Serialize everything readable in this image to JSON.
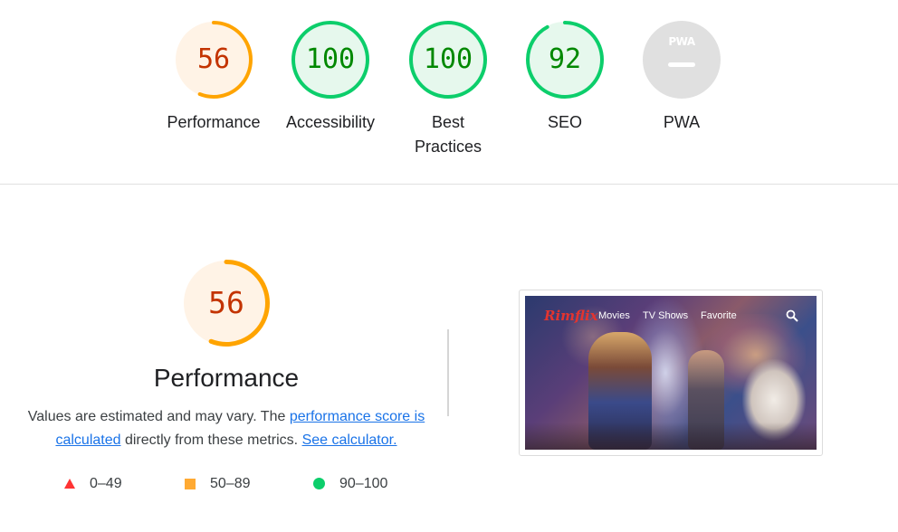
{
  "categories": [
    {
      "id": "performance",
      "score": 56,
      "score_text": "56",
      "label": "Performance",
      "status": "average"
    },
    {
      "id": "accessibility",
      "score": 100,
      "score_text": "100",
      "label": "Accessibility",
      "status": "pass"
    },
    {
      "id": "best-practices",
      "score": 100,
      "score_text": "100",
      "label_line1": "Best",
      "label_line2": "Practices",
      "status": "pass"
    },
    {
      "id": "seo",
      "score": 92,
      "score_text": "92",
      "label": "SEO",
      "status": "pass"
    },
    {
      "id": "pwa",
      "score_text": "PWA",
      "label": "PWA",
      "status": "na"
    }
  ],
  "colors": {
    "fail": "#ff3333",
    "average": "#ffa400",
    "average_text": "#c33300",
    "average_bg": "#fff3e6",
    "pass": "#0cce6b",
    "pass_text": "#008800",
    "pass_bg": "#e6f8ed",
    "na": "#e0e0e0",
    "link": "#1a73e8"
  },
  "performance_section": {
    "score": 56,
    "score_text": "56",
    "title": "Performance",
    "desc_prefix": "Values are estimated and may vary. The ",
    "link1": "performance score is calculated",
    "desc_middle": " directly from these metrics. ",
    "link2": "See calculator."
  },
  "legend": [
    {
      "icon": "red-triangle-icon",
      "range": "0–49"
    },
    {
      "icon": "orange-square-icon",
      "range": "50–89"
    },
    {
      "icon": "green-circle-icon",
      "range": "90–100"
    }
  ],
  "screenshot": {
    "logo": "Rimflix",
    "nav": [
      "Movies",
      "TV Shows",
      "Favorite"
    ],
    "search_icon": "search-icon"
  }
}
